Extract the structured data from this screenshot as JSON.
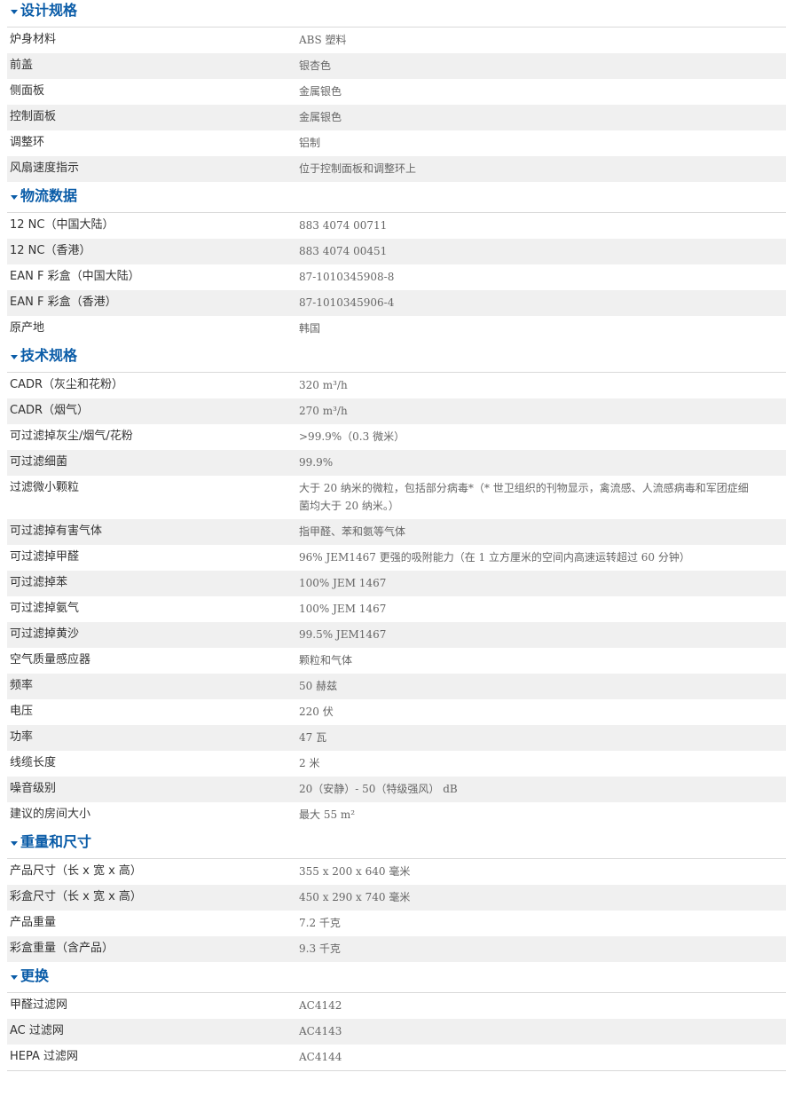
{
  "sections": [
    {
      "title": "设计规格",
      "rows": [
        {
          "k": "炉身材料",
          "v": "ABS 塑料"
        },
        {
          "k": "前盖",
          "v": "银杏色"
        },
        {
          "k": "侧面板",
          "v": "金属银色"
        },
        {
          "k": "控制面板",
          "v": "金属银色"
        },
        {
          "k": "调整环",
          "v": "铝制"
        },
        {
          "k": "风扇速度指示",
          "v": "位于控制面板和调整环上"
        }
      ]
    },
    {
      "title": "物流数据",
      "rows": [
        {
          "k": "12 NC（中国大陆）",
          "v": "883 4074 00711"
        },
        {
          "k": "12 NC（香港）",
          "v": "883 4074 00451"
        },
        {
          "k": "EAN F 彩盒（中国大陆）",
          "v": "87-1010345908-8"
        },
        {
          "k": "EAN F 彩盒（香港）",
          "v": "87-1010345906-4"
        },
        {
          "k": "原产地",
          "v": "韩国"
        }
      ]
    },
    {
      "title": "技术规格",
      "rows": [
        {
          "k": "CADR（灰尘和花粉）",
          "v": "320 m³/h"
        },
        {
          "k": "CADR（烟气）",
          "v": "270 m³/h"
        },
        {
          "k": "可过滤掉灰尘/烟气/花粉",
          "v": ">99.9%（0.3 微米）"
        },
        {
          "k": "可过滤细菌",
          "v": "99.9%"
        },
        {
          "k": "过滤微小颗粒",
          "v": "大于 20 纳米的微粒，包括部分病毒*（* 世卫组织的刊物显示，禽流感、人流感病毒和军团症细菌均大于 20 纳米。）"
        },
        {
          "k": "可过滤掉有害气体",
          "v": "指甲醛、苯和氨等气体"
        },
        {
          "k": "可过滤掉甲醛",
          "v": "96% JEM1467 更强的吸附能力（在 1 立方厘米的空间内高速运转超过 60 分钟）"
        },
        {
          "k": "可过滤掉苯",
          "v": "100% JEM 1467"
        },
        {
          "k": "可过滤掉氨气",
          "v": "100% JEM 1467"
        },
        {
          "k": "可过滤掉黄沙",
          "v": "99.5% JEM1467"
        },
        {
          "k": "空气质量感应器",
          "v": "颗粒和气体"
        },
        {
          "k": "频率",
          "v": "50 赫兹"
        },
        {
          "k": "电压",
          "v": "220 伏"
        },
        {
          "k": "功率",
          "v": "47 瓦"
        },
        {
          "k": "线缆长度",
          "v": "2 米"
        },
        {
          "k": "噪音级别",
          "v": "20（安静）- 50（特级强风） dB"
        },
        {
          "k": "建议的房间大小",
          "v": "最大 55 m²"
        }
      ]
    },
    {
      "title": "重量和尺寸",
      "rows": [
        {
          "k": "产品尺寸（长 x 宽 x 高）",
          "v": "355 x 200 x 640 毫米"
        },
        {
          "k": "彩盒尺寸（长 x 宽 x 高）",
          "v": "450 x 290 x 740 毫米"
        },
        {
          "k": "产品重量",
          "v": "7.2 千克"
        },
        {
          "k": "彩盒重量（含产品）",
          "v": "9.3 千克"
        }
      ]
    },
    {
      "title": "更换",
      "rows": [
        {
          "k": "甲醛过滤网",
          "v": "AC4142"
        },
        {
          "k": "AC 过滤网",
          "v": "AC4143"
        },
        {
          "k": "HEPA 过滤网",
          "v": "AC4144"
        }
      ]
    }
  ]
}
